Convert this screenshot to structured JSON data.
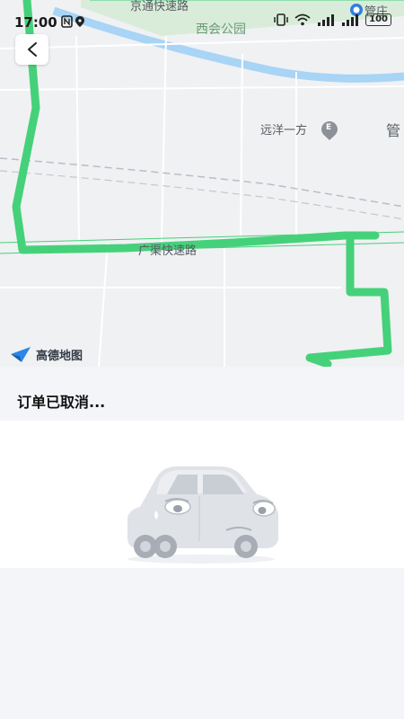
{
  "status_bar": {
    "time": "17:00",
    "battery": "100"
  },
  "map": {
    "labels": {
      "expressway_top": "京通快速路",
      "park": "西会公园",
      "subway_station": "管庄",
      "poi": "远洋一方",
      "poi_badge": "E",
      "district_partial": "管",
      "expressway_main": "广渠快速路"
    },
    "logo_text": "高德地图",
    "route_color": "#45d17a"
  },
  "order": {
    "status_text": "订单已取消..."
  }
}
